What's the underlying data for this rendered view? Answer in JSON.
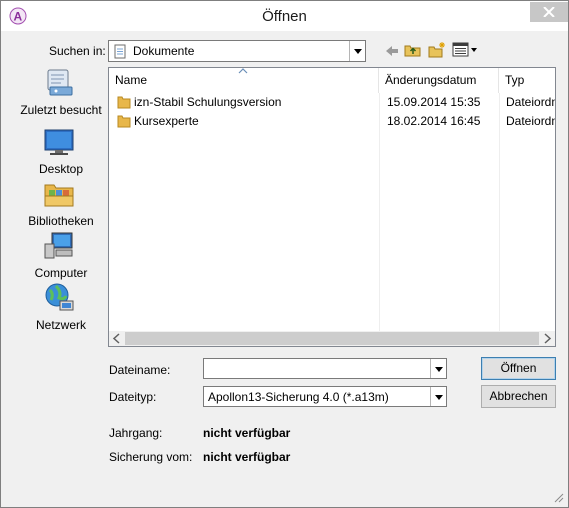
{
  "window": {
    "title": "Öffnen"
  },
  "look_in": {
    "label": "Suchen in:",
    "value": "Dokumente"
  },
  "toolbar": {
    "back_icon": "back-arrow-icon",
    "up_icon": "up-folder-icon",
    "new_folder_icon": "new-folder-icon",
    "view_icon": "view-menu-icon"
  },
  "places": [
    {
      "label": "Zuletzt besucht",
      "icon": "recent-places-icon"
    },
    {
      "label": "Desktop",
      "icon": "desktop-icon"
    },
    {
      "label": "Bibliotheken",
      "icon": "libraries-icon"
    },
    {
      "label": "Computer",
      "icon": "computer-icon"
    },
    {
      "label": "Netzwerk",
      "icon": "network-icon"
    }
  ],
  "columns": {
    "name": "Name",
    "date": "Änderungsdatum",
    "type": "Typ"
  },
  "files": [
    {
      "name": "izn-Stabil Schulungsversion",
      "date": "15.09.2014 15:35",
      "type": "Dateiordn"
    },
    {
      "name": "Kursexperte",
      "date": "18.02.2014 16:45",
      "type": "Dateiordn"
    }
  ],
  "filename": {
    "label": "Dateiname:",
    "value": ""
  },
  "filetype": {
    "label": "Dateityp:",
    "value": "Apollon13-Sicherung 4.0 (*.a13m)"
  },
  "buttons": {
    "open": "Öffnen",
    "cancel": "Abbrechen"
  },
  "info": {
    "year_label": "Jahrgang:",
    "year_value": "nicht verfügbar",
    "backup_label": "Sicherung vom:",
    "backup_value": "nicht verfügbar"
  },
  "colors": {
    "window_bg": "#f0f0f0",
    "default_button_border": "#3c7fb1",
    "folder": "#e8b74a"
  }
}
